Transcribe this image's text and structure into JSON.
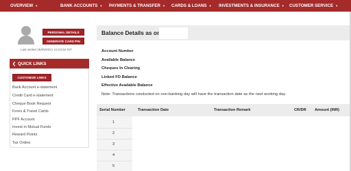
{
  "nav": {
    "items": [
      "OVERVIEW",
      "BANK ACCOUNTS",
      "PAYMENTS & TRANSFER",
      "CARDS & LOANS",
      "INVESTMENTS & INSURANCE",
      "CUSTOMER SERVICE"
    ]
  },
  "profile": {
    "personal_details_label": "PERSONAL DETAILS",
    "generate_pin_label": "GENERATE CARD PIN",
    "last_visited": "Last visited 25/05/2021 10:23:53 IST"
  },
  "quick_links": {
    "title": "QUICK LINKS",
    "customize_label": "CUSTOMIZE LINKS",
    "links": [
      "Bank Account e-statement",
      "Credit Card e-statement",
      "Cheque Book Request",
      "Forex & Travel Cards",
      "PPF Account",
      "Invest in Mutual Funds",
      "Reward Points",
      "Tax Online"
    ]
  },
  "balance": {
    "title": "Balance Details as on",
    "labels": [
      "Account Number",
      "Available Balance",
      "Cheques In Clearing",
      "Linked FD Balance",
      "Effective Available Balance"
    ],
    "note": "Note: Transactions conducted on non-banking day will have the transaction date as the next working day."
  },
  "table": {
    "headers": [
      "Serial Number",
      "Transaction Date",
      "Transaction Remark",
      "CR/DR",
      "Amount (INR)"
    ],
    "serials": [
      "1",
      "2",
      "3",
      "4",
      "5"
    ]
  },
  "colors": {
    "brand": "#a52a2a",
    "header_bg": "#ececec"
  }
}
